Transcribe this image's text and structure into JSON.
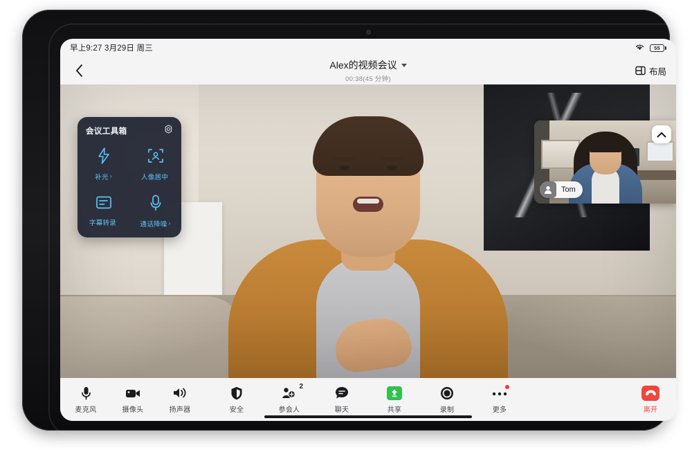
{
  "status_bar": {
    "time_date": "早上9:27 3月29日 周三",
    "wifi_icon": "wifi-icon",
    "battery_level": "55"
  },
  "header": {
    "back_icon": "back-chevron-icon",
    "title": "Alex的视频会议",
    "title_caret_icon": "chevron-down-icon",
    "subtitle": "00:38(45 分钟)",
    "layout_label": "布局",
    "layout_icon": "layout-icon"
  },
  "toolbox": {
    "title": "会议工具箱",
    "settings_icon": "gear-icon",
    "items": [
      {
        "label": "补光",
        "icon": "lightning-bolt-icon",
        "arrow": "›"
      },
      {
        "label": "人像居中",
        "icon": "person-focus-frame-icon",
        "arrow": ""
      },
      {
        "label": "字幕转录",
        "icon": "caption-box-icon",
        "arrow": ""
      },
      {
        "label": "通话降噪",
        "icon": "microphone-icon",
        "arrow": "›"
      }
    ],
    "accent_color": "#5ec2f7",
    "panel_color": "#1e2230"
  },
  "pip": {
    "participant_name": "Tom",
    "avatar_icon": "person-avatar-icon",
    "collapse_icon": "chevron-up-icon"
  },
  "bottom_bar": {
    "left_controls": [
      {
        "label": "麦克风",
        "icon": "microphone-icon"
      },
      {
        "label": "摄像头",
        "icon": "video-camera-icon"
      },
      {
        "label": "扬声器",
        "icon": "speaker-icon"
      }
    ],
    "center_controls": [
      {
        "label": "安全",
        "icon": "shield-icon",
        "badge": "",
        "dot": false
      },
      {
        "label": "参会人",
        "icon": "people-icon",
        "badge": "2",
        "dot": false
      },
      {
        "label": "聊天",
        "icon": "chat-bubble-icon",
        "badge": "",
        "dot": false
      },
      {
        "label": "共享",
        "icon": "share-up-arrow-icon",
        "badge": "",
        "dot": false
      },
      {
        "label": "录制",
        "icon": "record-circle-icon",
        "badge": "",
        "dot": false
      },
      {
        "label": "更多",
        "icon": "more-dots-icon",
        "badge": "",
        "dot": true
      }
    ],
    "leave": {
      "label": "离开",
      "icon": "hang-up-phone-icon",
      "color": "#f2453d"
    },
    "share_color": "#30c24e"
  }
}
